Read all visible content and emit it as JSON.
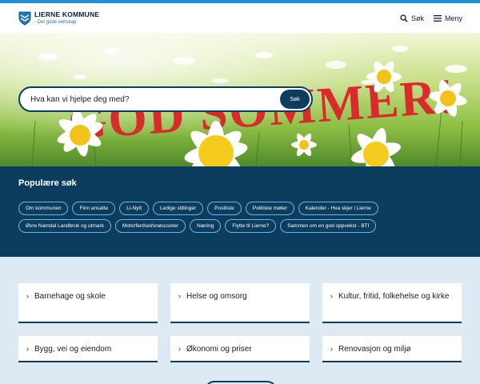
{
  "header": {
    "brand_name": "LIERNE KOMMUNE",
    "brand_tagline": "- Det gode vertskap",
    "search_label": "Søk",
    "menu_label": "Meny"
  },
  "hero": {
    "banner_text": "GOD SOMMER!",
    "search_placeholder": "Hva kan vi hjelpe deg med?",
    "search_button": "Søk"
  },
  "popular": {
    "title": "Populære søk",
    "items": [
      "Om kommunen",
      "Finn ansatte",
      "Li-Nytt",
      "Ledige stillinger",
      "Postliste",
      "Politiske møter",
      "Kalender - Hva skjer i Lierne",
      "Øvre Namdal Landbruk og utmark",
      "Motorferdsel/snøscooter",
      "Næring",
      "Flytte til Lierne?",
      "Sammen om en god oppvekst - BTI"
    ]
  },
  "services": {
    "items": [
      "Barnehage og skole",
      "Helse og omsorg",
      "Kultur, fritid, folkehelse og kirke",
      "Bygg, vei og eiendom",
      "Økonomi og priser",
      "Renovasjon og miljø"
    ]
  },
  "colors": {
    "accent_blue": "#1f8fd6",
    "navy": "#0c3d5e",
    "services_bg": "#dde9f3",
    "banner_red": "#d92b2b"
  },
  "icons": {
    "logo": "coat-of-arms-icon",
    "search": "search-icon",
    "menu": "hamburger-icon",
    "chevron": "chevron-right-icon"
  }
}
